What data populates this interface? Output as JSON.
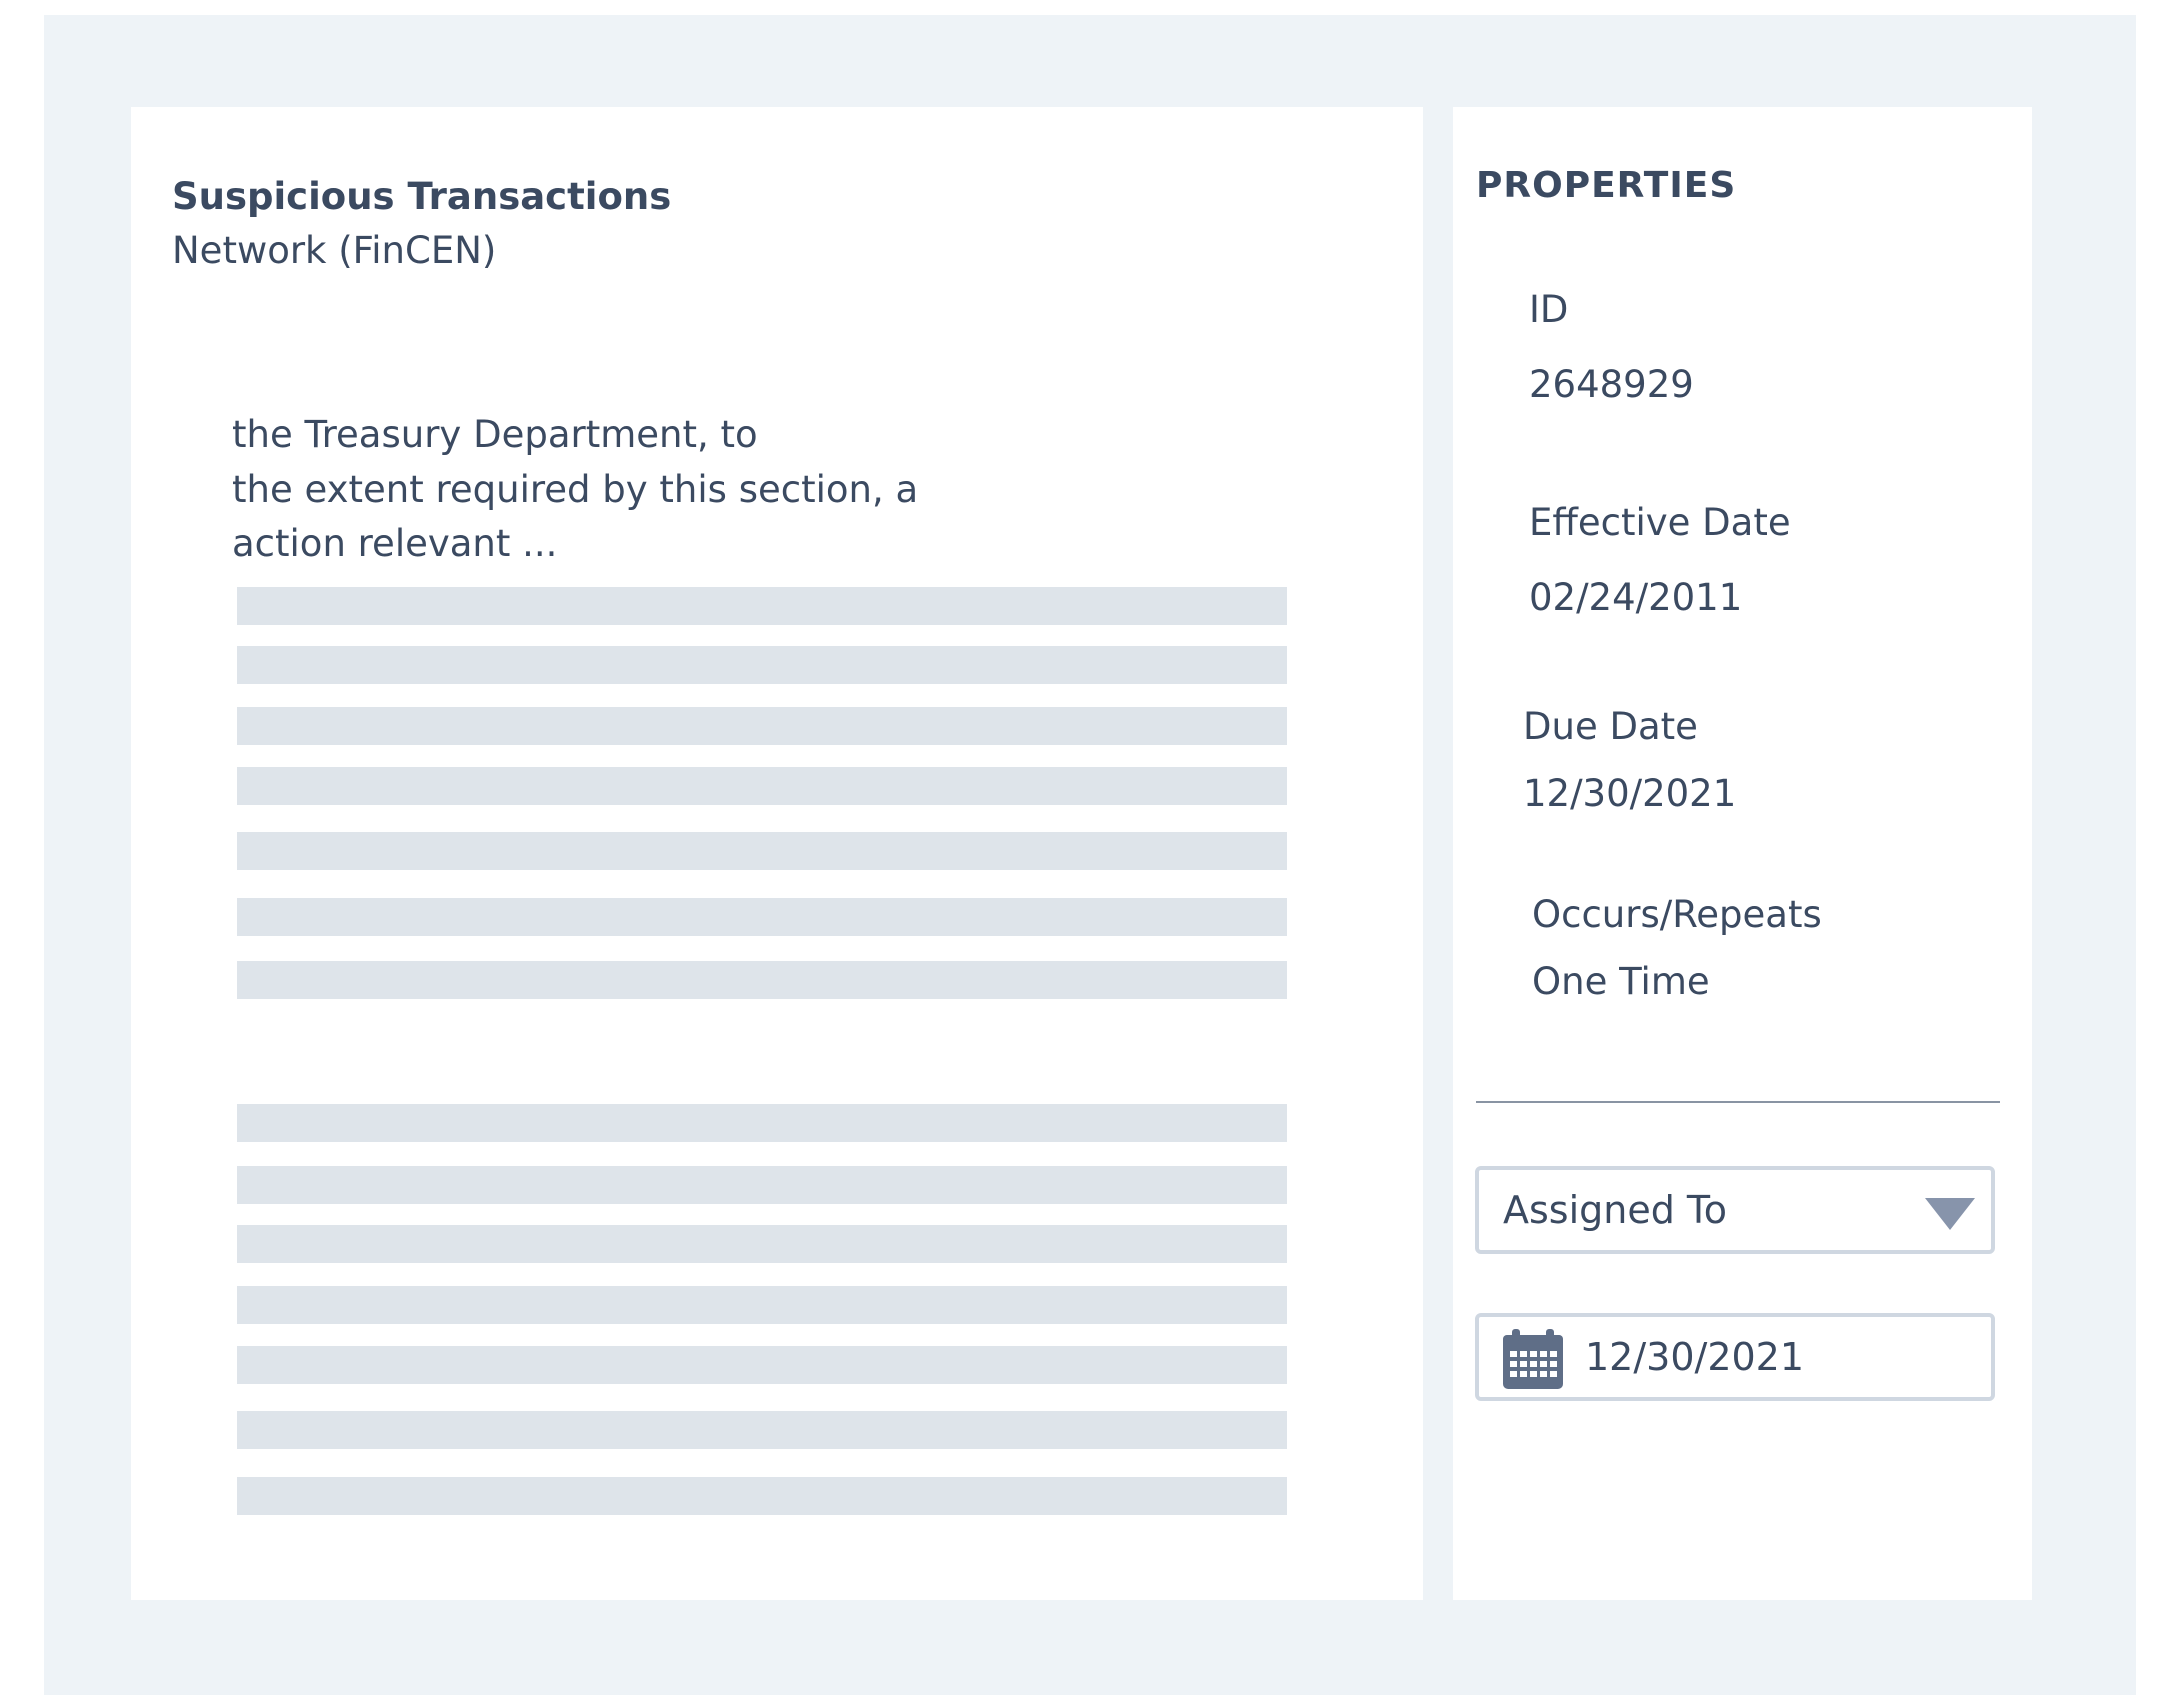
{
  "document": {
    "title": "Suspicious Transactions",
    "subtitle": "Network (FinCEN)",
    "excerpt_lines": [
      "the Treasury Department, to",
      "the extent required by this section, a",
      "action relevant ..."
    ]
  },
  "properties": {
    "heading": "PROPERTIES",
    "id_label": "ID",
    "id_value": "2648929",
    "effective_date_label": "Effective Date",
    "effective_date_value": "02/24/2011",
    "due_date_label": "Due Date",
    "due_date_value": "12/30/2021",
    "occurs_label": "Occurs/Repeats",
    "occurs_value": "One Time",
    "assigned_to_label": "Assigned To",
    "date_field_value": "12/30/2021"
  },
  "icons": {
    "dropdown": "chevron-down-icon",
    "date": "calendar-icon"
  },
  "colors": {
    "background": "#eef3f7",
    "panel": "#ffffff",
    "text": "#3b4a61",
    "placeholder": "#dee4ea",
    "border": "#cfd7e1",
    "icon": "#5f6e87"
  }
}
